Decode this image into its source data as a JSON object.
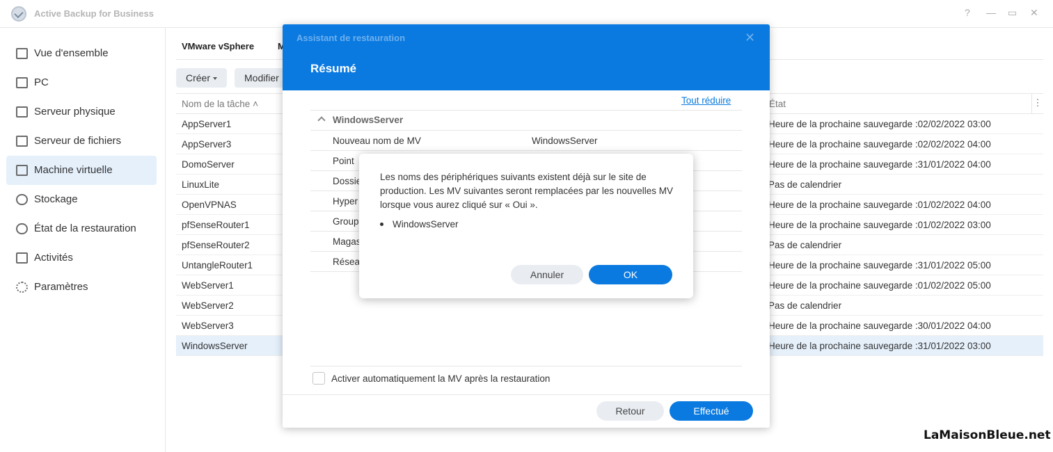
{
  "app": {
    "title": "Active Backup for Business"
  },
  "window_controls": {
    "help": "?",
    "minimize": "—",
    "maximize": "▭",
    "close": "✕"
  },
  "sidebar": {
    "items": [
      {
        "label": "Vue d'ensemble",
        "icon": "overview-icon"
      },
      {
        "label": "PC",
        "icon": "pc-icon"
      },
      {
        "label": "Serveur physique",
        "icon": "physical-server-icon"
      },
      {
        "label": "Serveur de fichiers",
        "icon": "file-server-icon"
      },
      {
        "label": "Machine virtuelle",
        "icon": "virtual-machine-icon",
        "active": true
      },
      {
        "label": "Stockage",
        "icon": "storage-icon"
      },
      {
        "label": "État de la restauration",
        "icon": "restore-status-icon"
      },
      {
        "label": "Activités",
        "icon": "activities-icon"
      },
      {
        "label": "Paramètres",
        "icon": "settings-icon"
      }
    ]
  },
  "main": {
    "tabs": [
      "VMware vSphere",
      "M"
    ],
    "toolbar": {
      "create": "Créer",
      "edit": "Modifier"
    },
    "grid": {
      "col_name": "Nom de la tâche",
      "col_state": "État",
      "rows": [
        {
          "name": "AppServer1",
          "state": "Heure de la prochaine sauvegarde :02/02/2022 03:00"
        },
        {
          "name": "AppServer3",
          "state": "Heure de la prochaine sauvegarde :02/02/2022 04:00"
        },
        {
          "name": "DomoServer",
          "state": "Heure de la prochaine sauvegarde :31/01/2022 04:00"
        },
        {
          "name": "LinuxLite",
          "state": "Pas de calendrier"
        },
        {
          "name": "OpenVPNAS",
          "state": "Heure de la prochaine sauvegarde :01/02/2022 04:00"
        },
        {
          "name": "pfSenseRouter1",
          "state": "Heure de la prochaine sauvegarde :01/02/2022 03:00"
        },
        {
          "name": "pfSenseRouter2",
          "state": "Pas de calendrier"
        },
        {
          "name": "UntangleRouter1",
          "state": "Heure de la prochaine sauvegarde :31/01/2022 05:00"
        },
        {
          "name": "WebServer1",
          "state": "Heure de la prochaine sauvegarde :01/02/2022 05:00"
        },
        {
          "name": "WebServer2",
          "state": "Pas de calendrier"
        },
        {
          "name": "WebServer3",
          "state": "Heure de la prochaine sauvegarde :30/01/2022 04:00"
        },
        {
          "name": "WindowsServer",
          "state": "Heure de la prochaine sauvegarde :31/01/2022 03:00",
          "selected": true
        }
      ]
    }
  },
  "wizard": {
    "title": "Assistant de restauration",
    "heading": "Résumé",
    "collapse_all": "Tout réduire",
    "group": "WindowsServer",
    "rows": [
      {
        "label": "Nouveau nom de MV",
        "value": "WindowsServer"
      },
      {
        "label": "Point",
        "value": ""
      },
      {
        "label": "Dossie",
        "value": ""
      },
      {
        "label": "Hyper",
        "value": ""
      },
      {
        "label": "Group",
        "value": ""
      },
      {
        "label": "Magas",
        "value": ""
      },
      {
        "label": "Résea",
        "value": ""
      }
    ],
    "auto_activate_label": "Activer automatiquement la MV après la restauration",
    "back_label": "Retour",
    "done_label": "Effectué"
  },
  "confirm": {
    "message": "Les noms des périphériques suivants existent déjà sur le site de production. Les MV suivantes seront remplacées par les nouvelles MV lorsque vous aurez cliqué sur « Oui ».",
    "items": [
      "WindowsServer"
    ],
    "cancel_label": "Annuler",
    "ok_label": "OK"
  },
  "watermark": "LaMaisonBleue.net",
  "colors": {
    "accent": "#0a7ae0",
    "selected_bg": "#e5f0fb"
  }
}
